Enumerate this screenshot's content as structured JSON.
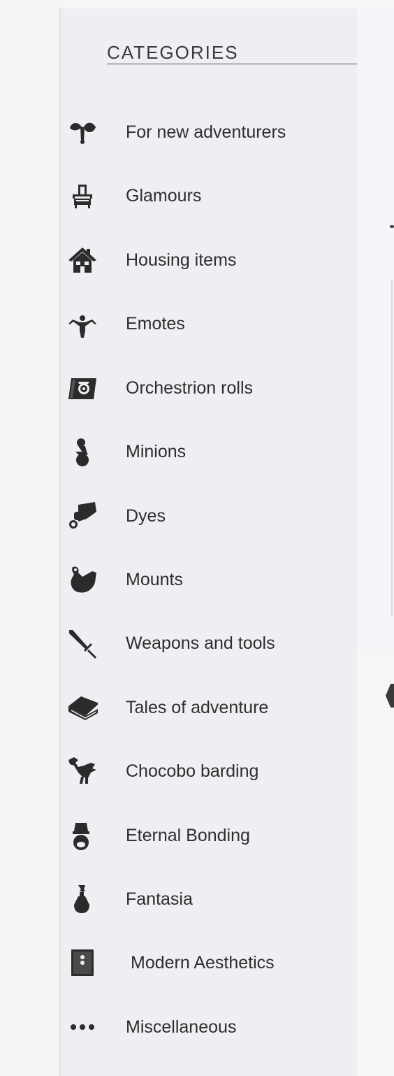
{
  "sidebar": {
    "title": "CATEGORIES",
    "items": [
      {
        "label": "For new adventurers",
        "icon": "sprout-icon"
      },
      {
        "label": "Glamours",
        "icon": "glamour-dresser-icon"
      },
      {
        "label": "Housing items",
        "icon": "house-icon"
      },
      {
        "label": "Emotes",
        "icon": "emote-figure-icon"
      },
      {
        "label": "Orchestrion rolls",
        "icon": "orchestrion-roll-icon"
      },
      {
        "label": "Minions",
        "icon": "minion-icon"
      },
      {
        "label": "Dyes",
        "icon": "dye-icon"
      },
      {
        "label": "Mounts",
        "icon": "mount-icon"
      },
      {
        "label": "Weapons and tools",
        "icon": "sword-icon"
      },
      {
        "label": "Tales of adventure",
        "icon": "book-icon"
      },
      {
        "label": "Chocobo barding",
        "icon": "chocobo-icon"
      },
      {
        "label": "Eternal Bonding",
        "icon": "eternal-bonding-icon"
      },
      {
        "label": "Fantasia",
        "icon": "fantasia-potion-icon"
      },
      {
        "label": "Modern Aesthetics",
        "icon": "modern-aesthetics-icon"
      },
      {
        "label": "Miscellaneous",
        "icon": "ellipsis-icon"
      }
    ]
  },
  "colors": {
    "icon": "#2b2b2b",
    "text": "#2e2e2e",
    "sidebar_bg": "#efeef3",
    "page_bg": "#f8f5f7"
  }
}
